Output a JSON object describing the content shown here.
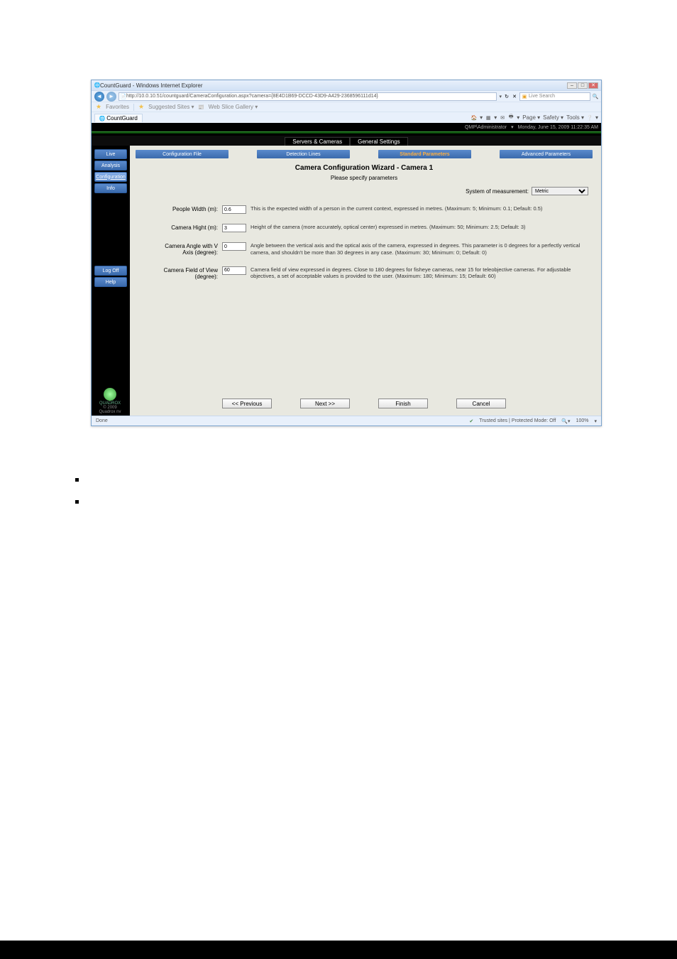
{
  "window": {
    "title": "CountGuard - Windows Internet Explorer",
    "address_prefix": "http://",
    "address": "10.0.10.51/countguard/CameraConfiguration.aspx?camera={8E4D1B69-DCCD-43D9-A429-2368596111d14}",
    "search_placeholder": "Live Search",
    "favorites_label": "Favorites",
    "fav_links": [
      "Suggested Sites ▾",
      "Web Slice Gallery ▾"
    ],
    "tab_label": "CountGuard",
    "ie_tools": [
      "Page ▾",
      "Safety ▾",
      "Tools ▾"
    ]
  },
  "topbar": {
    "user": "QMP\\Administrator",
    "datetime": "Monday, June 15, 2009 11:22:35 AM"
  },
  "apptabs": [
    "Servers & Cameras",
    "General Settings"
  ],
  "sidebar": {
    "items": [
      "Live",
      "Analysis",
      "Configuration",
      "Info"
    ],
    "lower": [
      "Log Off",
      "Help"
    ],
    "brand": "QUADROX",
    "copyright": "© 2009 Quadrox nv"
  },
  "wizard": {
    "steps": [
      "Configuration File",
      "Detection Lines",
      "Standard Parameters",
      "Advanced Parameters"
    ],
    "title": "Camera Configuration Wizard - Camera 1",
    "subtitle": "Please specify parameters",
    "measure_label": "System of measurement:",
    "measure_value": "Metric",
    "params": [
      {
        "label": "People Width (m):",
        "value": "0.6",
        "desc": "This is the expected width of a person in the current context, expressed in metres. (Maximum: 5; Minimum: 0.1; Default: 0.5)"
      },
      {
        "label": "Camera Hight (m):",
        "value": "3",
        "desc": "Height of the camera (more accurately, optical center) expressed in metres. (Maximum: 50; Minimum: 2.5; Default: 3)"
      },
      {
        "label": "Camera Angle with V Axis (degree):",
        "value": "0",
        "desc": "Angle between the vertical axis and the optical axis of the camera, expressed in degrees. This parameter is 0 degrees for a perfectly vertical camera, and shouldn't be more than 30 degrees in any case. (Maximum: 30; Minimum: 0; Default: 0)"
      },
      {
        "label": "Camera Field of View (degree):",
        "value": "60",
        "desc": "Camera field of view expressed in degrees. Close to 180 degrees for fisheye cameras, near 15 for teleobjective cameras. For adjustable objectives, a set of acceptable values is provided to the user. (Maximum: 180; Minimum: 15; Default: 60)"
      }
    ],
    "buttons": {
      "prev": "<< Previous",
      "next": "Next >>",
      "finish": "Finish",
      "cancel": "Cancel"
    }
  },
  "statusbar": {
    "done": "Done",
    "trusted": "Trusted sites | Protected Mode: Off",
    "zoom": "100%"
  }
}
